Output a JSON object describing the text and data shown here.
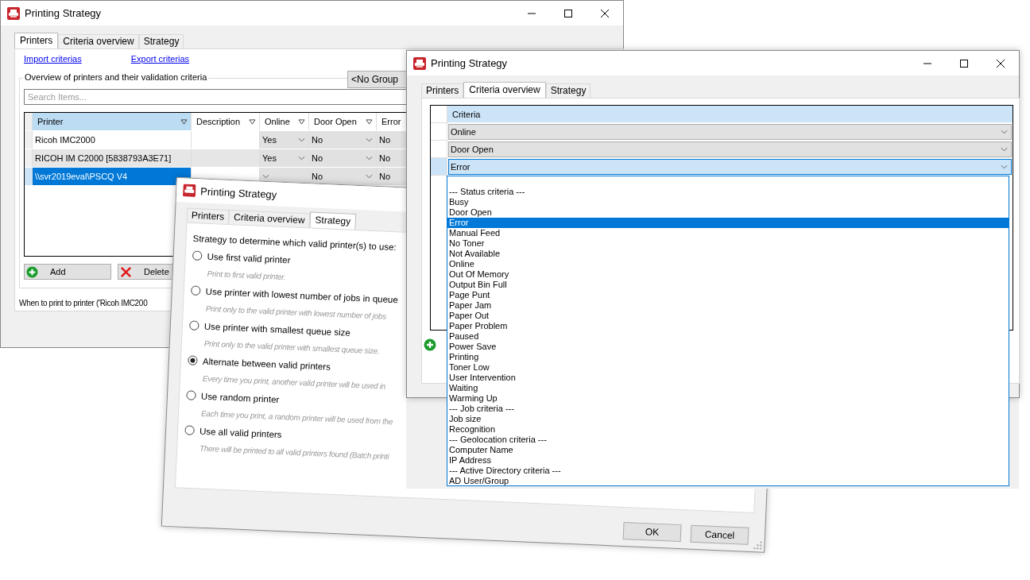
{
  "printers_window": {
    "title": "Printing Strategy",
    "tabs": [
      {
        "label": "Printers",
        "selected": true
      },
      {
        "label": "Criteria overview",
        "selected": false
      },
      {
        "label": "Strategy",
        "selected": false
      }
    ],
    "links": [
      "Import criterias",
      "Export criterias"
    ],
    "group_title": "Overview of printers and their validation criteria",
    "group_button": "<No Group",
    "search": {
      "placeholder": "Search Items..."
    },
    "table": {
      "columns": [
        "Printer",
        "Description",
        "Online",
        "Door Open",
        "Error"
      ],
      "rows": [
        {
          "printer": "Ricoh IMC2000",
          "online": "Yes",
          "door_open": "No",
          "error": "No",
          "selected": false
        },
        {
          "printer": "RICOH IM C2000 [5838793A3E71]",
          "online": "Yes",
          "door_open": "No",
          "error": "No",
          "selected": false
        },
        {
          "printer": "\\\\svr2019eval\\PSCQ V4",
          "door_open": "No",
          "error": "No",
          "selected": true
        }
      ]
    },
    "buttons": [
      "Add",
      "Delete"
    ],
    "footer_text": "When to print to printer ('Ricoh IMC200"
  },
  "strategy_window": {
    "title": "Printing Strategy",
    "tabs": [
      {
        "label": "Printers",
        "selected": false
      },
      {
        "label": "Criteria overview",
        "selected": false
      },
      {
        "label": "Strategy",
        "selected": true
      }
    ],
    "heading": "Strategy to determine which valid printer(s) to use:",
    "options": [
      {
        "label": "Use first valid printer",
        "description": "Print to first valid printer.",
        "selected": false
      },
      {
        "label": "Use printer with lowest number of jobs in queue",
        "description": "Print only to the valid printer with lowest number of jobs",
        "selected": false
      },
      {
        "label": "Use printer with smallest queue size",
        "description": "Print only to the valid printer with smallest queue size.",
        "selected": false
      },
      {
        "label": "Alternate between valid printers",
        "description": "Every time you print, another valid printer will be used in",
        "selected": true
      },
      {
        "label": "Use random printer",
        "description": "Each time you print, a random printer will be used from the",
        "selected": false
      },
      {
        "label": "Use all valid printers",
        "description": "There will be printed to all valid printers found (Batch printi",
        "selected": false
      }
    ],
    "buttons": [
      "OK",
      "Cancel"
    ]
  },
  "criteria_window": {
    "title": "Printing Strategy",
    "tabs": [
      {
        "label": "Printers",
        "selected": false
      },
      {
        "label": "Criteria overview",
        "selected": true
      },
      {
        "label": "Strategy",
        "selected": false
      }
    ],
    "column": "Criteria",
    "rows": [
      {
        "value": "Online",
        "selected": false
      },
      {
        "value": "Door Open",
        "selected": false
      },
      {
        "value": "Error",
        "selected": true
      }
    ],
    "dropdown": [
      {
        "label": "--- Status criteria ---",
        "selected": false
      },
      {
        "label": "Busy",
        "selected": false
      },
      {
        "label": "Door Open",
        "selected": false
      },
      {
        "label": "Error",
        "selected": true
      },
      {
        "label": "Manual Feed",
        "selected": false
      },
      {
        "label": "No Toner",
        "selected": false
      },
      {
        "label": "Not Available",
        "selected": false
      },
      {
        "label": "Online",
        "selected": false
      },
      {
        "label": "Out Of Memory",
        "selected": false
      },
      {
        "label": "Output Bin Full",
        "selected": false
      },
      {
        "label": "Page Punt",
        "selected": false
      },
      {
        "label": "Paper Jam",
        "selected": false
      },
      {
        "label": "Paper Out",
        "selected": false
      },
      {
        "label": "Paper Problem",
        "selected": false
      },
      {
        "label": "Paused",
        "selected": false
      },
      {
        "label": "Power Save",
        "selected": false
      },
      {
        "label": "Printing",
        "selected": false
      },
      {
        "label": "Toner Low",
        "selected": false
      },
      {
        "label": "User Intervention",
        "selected": false
      },
      {
        "label": "Waiting",
        "selected": false
      },
      {
        "label": "Warming Up",
        "selected": false
      },
      {
        "label": "--- Job criteria ---",
        "selected": false
      },
      {
        "label": "Job size",
        "selected": false
      },
      {
        "label": "Recognition",
        "selected": false
      },
      {
        "label": "--- Geolocation criteria ---",
        "selected": false
      },
      {
        "label": "Computer Name",
        "selected": false
      },
      {
        "label": "IP Address",
        "selected": false
      },
      {
        "label": "--- Active Directory criteria ---",
        "selected": false
      },
      {
        "label": "AD User/Group",
        "selected": false
      }
    ]
  }
}
